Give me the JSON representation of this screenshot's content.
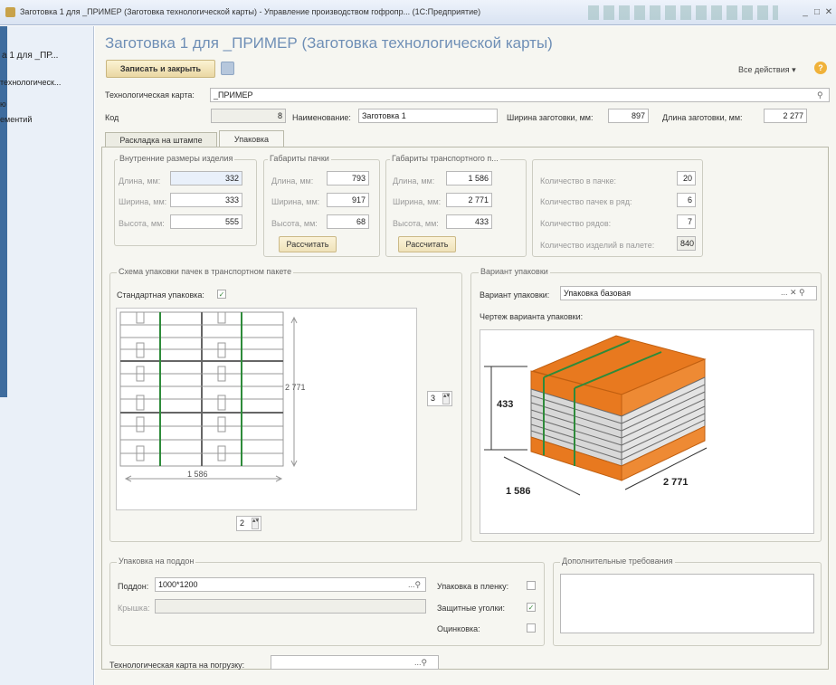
{
  "window": {
    "title": "Заготовка 1 для _ПРИМЕР (Заготовка технологической карты) - Управление производством гофропр... (1С:Предприятие)"
  },
  "sidebar": {
    "items": [
      "а 1 для _ПР...",
      "технологическ...",
      "ю",
      "ементий"
    ]
  },
  "form": {
    "title": "Заготовка 1 для _ПРИМЕР (Заготовка технологической карты)",
    "save_close": "Записать и закрыть",
    "all_actions": "Все действия ▾",
    "tech_card_label": "Технологическая карта:",
    "tech_card_value": "_ПРИМЕР",
    "code_label": "Код",
    "code_value": "8",
    "name_label": "Наименование:",
    "name_value": "Заготовка 1",
    "width_label": "Ширина заготовки, мм:",
    "width_value": "897",
    "length_label": "Длина заготовки, мм:",
    "length_value": "2 277"
  },
  "tabs": [
    "Раскладка на штампе",
    "Упаковка"
  ],
  "inner": {
    "title": "Внутренние размеры изделия",
    "length_label": "Длина, мм:",
    "length": "332",
    "width_label": "Ширина, мм:",
    "width": "333",
    "height_label": "Высота, мм:",
    "height": "555"
  },
  "pack": {
    "title": "Габариты пачки",
    "length_label": "Длина, мм:",
    "length": "793",
    "width_label": "Ширина, мм:",
    "width": "917",
    "height_label": "Высота, мм:",
    "height": "68",
    "calc": "Рассчитать"
  },
  "transport": {
    "title": "Габариты транспортного п...",
    "length_label": "Длина, мм:",
    "length": "1 586",
    "width_label": "Ширина, мм:",
    "width": "2 771",
    "height_label": "Высота, мм:",
    "height": "433",
    "calc": "Рассчитать"
  },
  "counts": {
    "in_pack_label": "Количество в пачке:",
    "in_pack": "20",
    "per_row_label": "Количество пачек в ряд:",
    "per_row": "6",
    "rows_label": "Количество рядов:",
    "rows": "7",
    "on_pallet_label": "Количество изделий в палете:",
    "on_pallet": "840"
  },
  "scheme": {
    "title": "Схема упаковки пачек в транспортном пакете",
    "standard_label": "Стандартная упаковка:",
    "dim_vertical": "2 771",
    "dim_horizontal": "1 586",
    "spin_right": "3",
    "spin_bottom": "2"
  },
  "variant": {
    "title": "Вариант упаковки",
    "label": "Вариант упаковки:",
    "value": "Упаковка базовая",
    "drawing_label": "Чертеж варианта упаковки:",
    "dim_height": "433",
    "dim_length": "1 586",
    "dim_width": "2 771"
  },
  "pallet": {
    "title": "Упаковка на поддон",
    "pallet_label": "Поддон:",
    "pallet_value": "1000*1200",
    "lid_label": "Крышка:",
    "film_label": "Упаковка в пленку:",
    "corners_label": "Защитные уголки:",
    "banding_label": "Оцинковка:"
  },
  "extra": {
    "title": "Дополнительные требования"
  },
  "load_card_label": "Технологическая карта на погрузку:",
  "colors": {
    "orange": "#e8791f",
    "green": "#2e8b3a",
    "title_blue": "#6f8fb6"
  }
}
